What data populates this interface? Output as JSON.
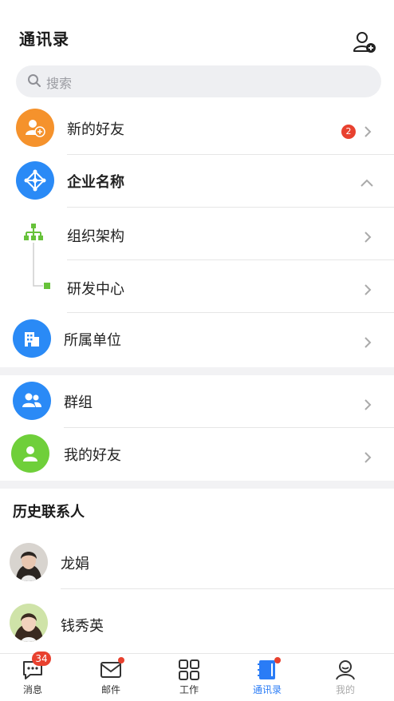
{
  "header": {
    "title": "通讯录",
    "add_contact_icon": "add-user-icon"
  },
  "search": {
    "placeholder": "搜索",
    "icon": "search-icon"
  },
  "items": {
    "new_friends": {
      "label": "新的好友",
      "badge": "2",
      "color": "#f5922c"
    },
    "company": {
      "label": "企业名称",
      "color": "#2a8af6"
    },
    "org": {
      "label": "组织架构",
      "color": "#67c23a"
    },
    "dept": {
      "label": "研发中心",
      "color": "#67c23a"
    },
    "units": {
      "label": "所属单位",
      "color": "#2a8af6"
    },
    "groups": {
      "label": "群组",
      "color": "#2a8af6"
    },
    "my_friends": {
      "label": "我的好友",
      "color": "#6fcf3a"
    }
  },
  "history": {
    "title": "历史联系人",
    "contacts": [
      {
        "name": "龙娟"
      },
      {
        "name": "钱秀英"
      }
    ]
  },
  "tabbar": {
    "tabs": [
      {
        "label": "消息",
        "badge": "34",
        "icon": "chat-icon"
      },
      {
        "label": "邮件",
        "icon": "mail-icon"
      },
      {
        "label": "工作",
        "icon": "grid-icon"
      },
      {
        "label": "通讯录",
        "icon": "contacts-book-icon",
        "active": true
      },
      {
        "label": "我的",
        "icon": "profile-icon"
      }
    ],
    "active_color": "#2a7cf6"
  }
}
